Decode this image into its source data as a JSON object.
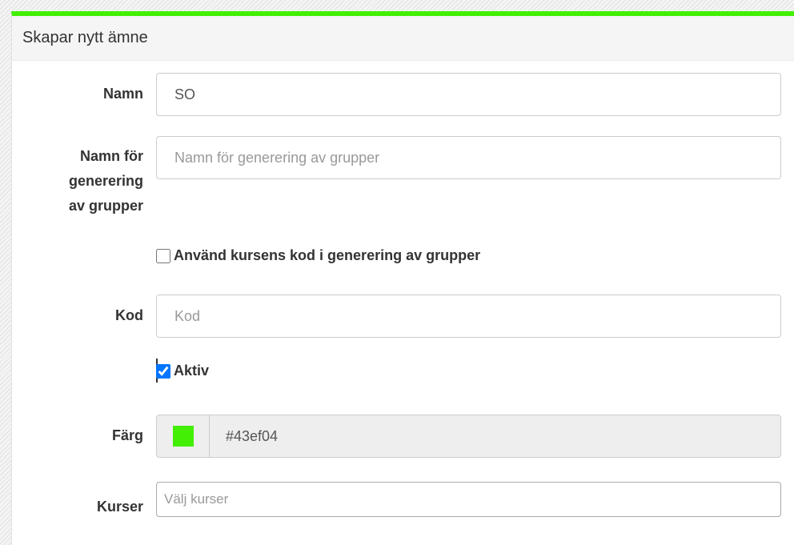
{
  "panel": {
    "title": "Skapar nytt ämne",
    "accent_color": "#43ef04"
  },
  "form": {
    "namn": {
      "label": "Namn",
      "value": "SO",
      "placeholder": ""
    },
    "namn_generering": {
      "label_lines": [
        "Namn för",
        "generering",
        "av grupper"
      ],
      "value": "",
      "placeholder": "Namn för generering av grupper"
    },
    "use_course_code": {
      "label": "Använd kursens kod i generering av grupper",
      "checked": false
    },
    "kod": {
      "label": "Kod",
      "value": "",
      "placeholder": "Kod"
    },
    "aktiv": {
      "label": "Aktiv",
      "checked": true
    },
    "farg": {
      "label": "Färg",
      "value": "#43ef04",
      "swatch_color": "#43ef04"
    },
    "kurser": {
      "label": "Kurser",
      "placeholder": "Välj kurser"
    }
  }
}
